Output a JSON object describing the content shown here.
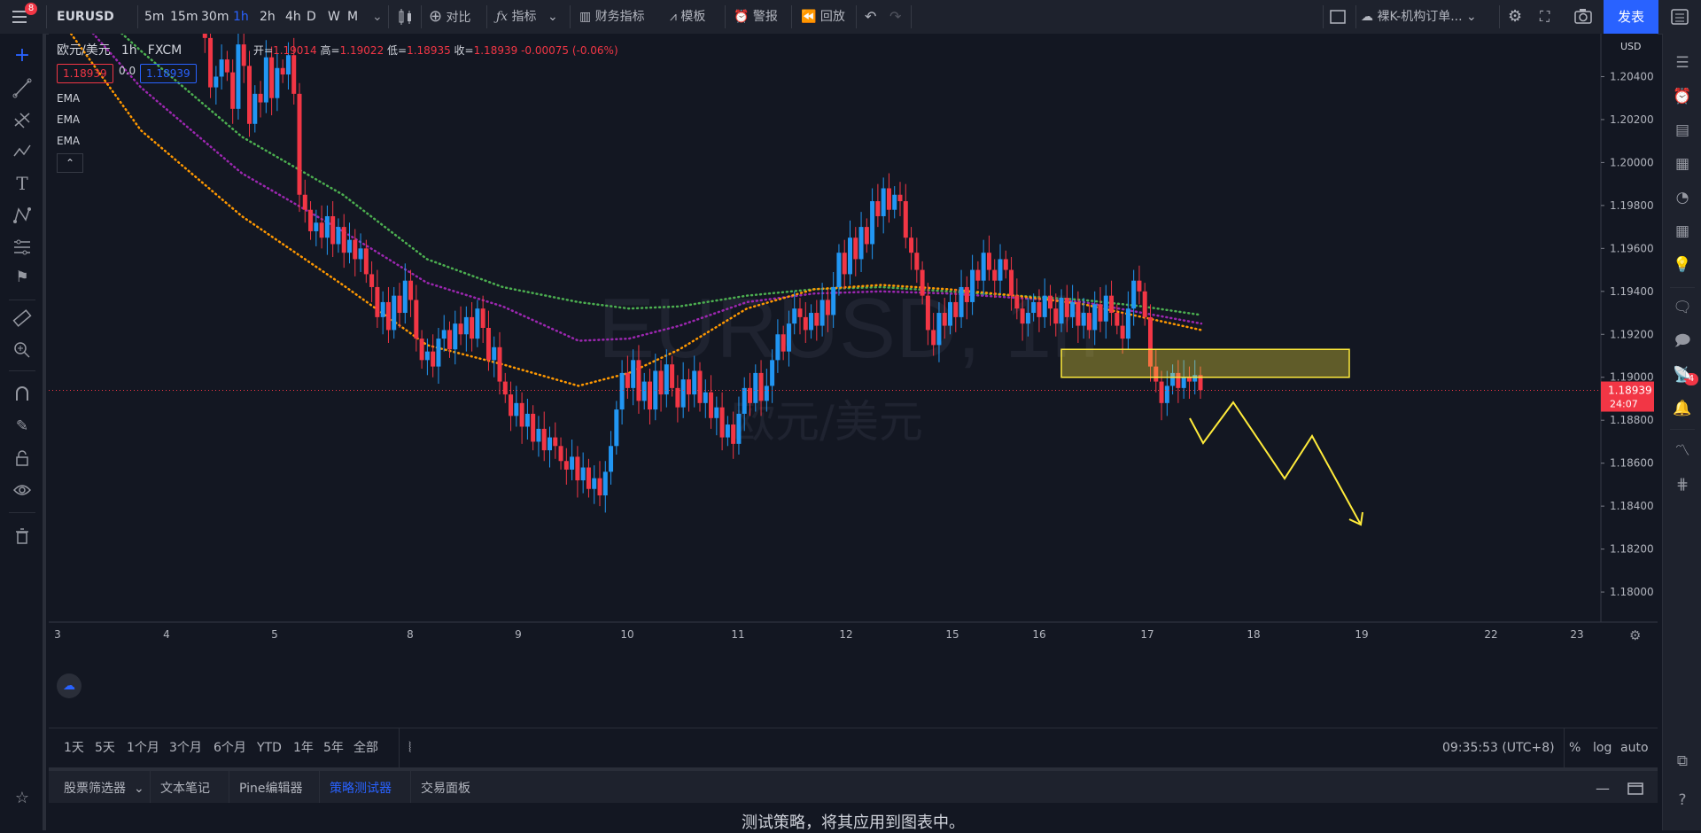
{
  "toolbar": {
    "notifications": "8",
    "symbol": "EURUSD",
    "intervals": [
      "5m",
      "15m",
      "30m",
      "1h",
      "2h",
      "4h",
      "D",
      "W",
      "M"
    ],
    "active_interval": "1h",
    "compare": "对比",
    "indicators": "指标",
    "financials": "财务指标",
    "templates": "模板",
    "alerts": "警报",
    "replay": "回放",
    "layout_name": "裸K-机构订单...",
    "publish": "发表"
  },
  "legend": {
    "title": "欧元/美元",
    "interval": "1h",
    "source": "FXCM",
    "open_label": "开=",
    "open": "1.19014",
    "high_label": "高=",
    "high": "1.19022",
    "low_label": "低=",
    "low": "1.18935",
    "close_label": "收=",
    "close": "1.18939",
    "change": "-0.00075 (-0.06%)",
    "bid": "1.18939",
    "spread": "0.0",
    "ask": "1.18939",
    "indicators": [
      "EMA",
      "EMA",
      "EMA"
    ]
  },
  "chart_data": {
    "type": "candlestick",
    "symbol": "EURUSD",
    "watermark_symbol": "EURUSD, 1h",
    "watermark_name": "欧元/美元",
    "currency": "USD",
    "price_ticks": [
      "1.20400",
      "1.20200",
      "1.20000",
      "1.19800",
      "1.19600",
      "1.19400",
      "1.19200",
      "1.19000",
      "1.18800",
      "1.18600",
      "1.18400",
      "1.18200",
      "1.18000"
    ],
    "price_tick_values": [
      1.204,
      1.202,
      1.2,
      1.198,
      1.196,
      1.194,
      1.192,
      1.19,
      1.188,
      1.186,
      1.184,
      1.182,
      1.18
    ],
    "time_ticks": [
      "3",
      "4",
      "5",
      "8",
      "9",
      "10",
      "11",
      "12",
      "15",
      "16",
      "17",
      "18",
      "19",
      "22",
      "23"
    ],
    "current_price": "1.18939",
    "countdown": "24:07",
    "ylim": [
      1.1786,
      1.206
    ],
    "ema_series": [
      {
        "color": "#4caf50",
        "points": [
          [
            0,
            1.2095
          ],
          [
            60,
            1.2052
          ],
          [
            120,
            1.2012
          ],
          [
            180,
            1.1985
          ],
          [
            230,
            1.1955
          ],
          [
            275,
            1.1942
          ],
          [
            320,
            1.1935
          ],
          [
            350,
            1.1932
          ],
          [
            380,
            1.1933
          ],
          [
            420,
            1.1938
          ],
          [
            460,
            1.1941
          ],
          [
            500,
            1.1942
          ],
          [
            540,
            1.194
          ],
          [
            580,
            1.1938
          ],
          [
            620,
            1.1936
          ],
          [
            655,
            1.1933
          ],
          [
            690,
            1.1929
          ]
        ]
      },
      {
        "color": "#9c27b0",
        "points": [
          [
            0,
            1.2088
          ],
          [
            60,
            1.2035
          ],
          [
            120,
            1.1995
          ],
          [
            180,
            1.1968
          ],
          [
            230,
            1.1944
          ],
          [
            275,
            1.1933
          ],
          [
            320,
            1.1917
          ],
          [
            350,
            1.1918
          ],
          [
            380,
            1.1924
          ],
          [
            420,
            1.1935
          ],
          [
            460,
            1.1939
          ],
          [
            500,
            1.194
          ],
          [
            540,
            1.1939
          ],
          [
            580,
            1.1937
          ],
          [
            620,
            1.1935
          ],
          [
            655,
            1.193
          ],
          [
            690,
            1.1925
          ]
        ]
      },
      {
        "color": "#ff9800",
        "points": [
          [
            0,
            1.208
          ],
          [
            60,
            1.2015
          ],
          [
            120,
            1.1975
          ],
          [
            180,
            1.1943
          ],
          [
            230,
            1.1915
          ],
          [
            275,
            1.1906
          ],
          [
            320,
            1.1896
          ],
          [
            350,
            1.1902
          ],
          [
            380,
            1.1913
          ],
          [
            420,
            1.1932
          ],
          [
            460,
            1.1941
          ],
          [
            500,
            1.1943
          ],
          [
            540,
            1.1941
          ],
          [
            580,
            1.1938
          ],
          [
            620,
            1.1934
          ],
          [
            655,
            1.1928
          ],
          [
            690,
            1.1922
          ]
        ]
      }
    ],
    "candles": [
      1.2085,
      1.2058,
      1.2035,
      1.204,
      1.2048,
      1.2042,
      1.2025,
      1.2055,
      1.2045,
      1.2018,
      1.2032,
      1.2028,
      1.2049,
      1.203,
      1.2044,
      1.2041,
      1.205,
      1.2032,
      1.1985,
      1.1978,
      1.1968,
      1.1972,
      1.1965,
      1.1975,
      1.1962,
      1.197,
      1.1958,
      1.1964,
      1.1955,
      1.196,
      1.1948,
      1.1942,
      1.1928,
      1.1935,
      1.1922,
      1.1938,
      1.193,
      1.1945,
      1.1936,
      1.1918,
      1.1908,
      1.1912,
      1.1905,
      1.1918,
      1.1922,
      1.1913,
      1.1925,
      1.192,
      1.1928,
      1.1918,
      1.1932,
      1.1923,
      1.1908,
      1.1914,
      1.1898,
      1.1892,
      1.1882,
      1.1888,
      1.1877,
      1.1883,
      1.187,
      1.1876,
      1.1866,
      1.1872,
      1.1868,
      1.1861,
      1.1857,
      1.1863,
      1.1852,
      1.1858,
      1.1848,
      1.1853,
      1.1845,
      1.1856,
      1.1868,
      1.1885,
      1.1902,
      1.1895,
      1.1908,
      1.1889,
      1.1898,
      1.1885,
      1.1903,
      1.1892,
      1.1906,
      1.1895,
      1.1886,
      1.1899,
      1.1892,
      1.1903,
      1.1888,
      1.1893,
      1.1881,
      1.1886,
      1.1872,
      1.1878,
      1.1869,
      1.1883,
      1.1895,
      1.1888,
      1.1902,
      1.1889,
      1.1896,
      1.1908,
      1.192,
      1.1912,
      1.1925,
      1.1932,
      1.1928,
      1.1922,
      1.193,
      1.1924,
      1.1936,
      1.1929,
      1.1942,
      1.1958,
      1.1948,
      1.1965,
      1.1955,
      1.197,
      1.1962,
      1.1982,
      1.1975,
      1.1988,
      1.1978,
      1.1985,
      1.1982,
      1.1965,
      1.1958,
      1.195,
      1.1938,
      1.1922,
      1.1915,
      1.193,
      1.1924,
      1.1935,
      1.1928,
      1.1942,
      1.1935,
      1.195,
      1.1945,
      1.1958,
      1.195,
      1.1945,
      1.1955,
      1.195,
      1.1938,
      1.1932,
      1.1925,
      1.193,
      1.1935,
      1.1928,
      1.1938,
      1.1932,
      1.1925,
      1.1937,
      1.1928,
      1.1935,
      1.1924,
      1.193,
      1.1922,
      1.1934,
      1.1926,
      1.1938,
      1.193,
      1.1924,
      1.1918,
      1.1932,
      1.1945,
      1.194,
      1.1928,
      1.1905,
      1.1898,
      1.1888,
      1.1896,
      1.1902,
      1.1895,
      1.19,
      1.1898,
      1.1901,
      1.1894
    ]
  },
  "drawings": {
    "zone_top": 1.1913,
    "zone_bottom": 1.19,
    "zone_color": "#ffeb3b",
    "path_color": "#ffeb3b"
  },
  "rangebar": {
    "ranges": [
      "1天",
      "5天",
      "1个月",
      "3个月",
      "6个月",
      "YTD",
      "1年",
      "5年",
      "全部"
    ],
    "clock": "09:35:53 (UTC+8)",
    "percent": "%",
    "log": "log",
    "auto": "auto"
  },
  "bottom_panel": {
    "tabs": [
      "股票筛选器",
      "文本笔记",
      "Pine编辑器",
      "策略测试器",
      "交易面板"
    ],
    "active_tab": "策略测试器",
    "message": "测试策略，将其应用到图表中。"
  },
  "right_badge": "4"
}
